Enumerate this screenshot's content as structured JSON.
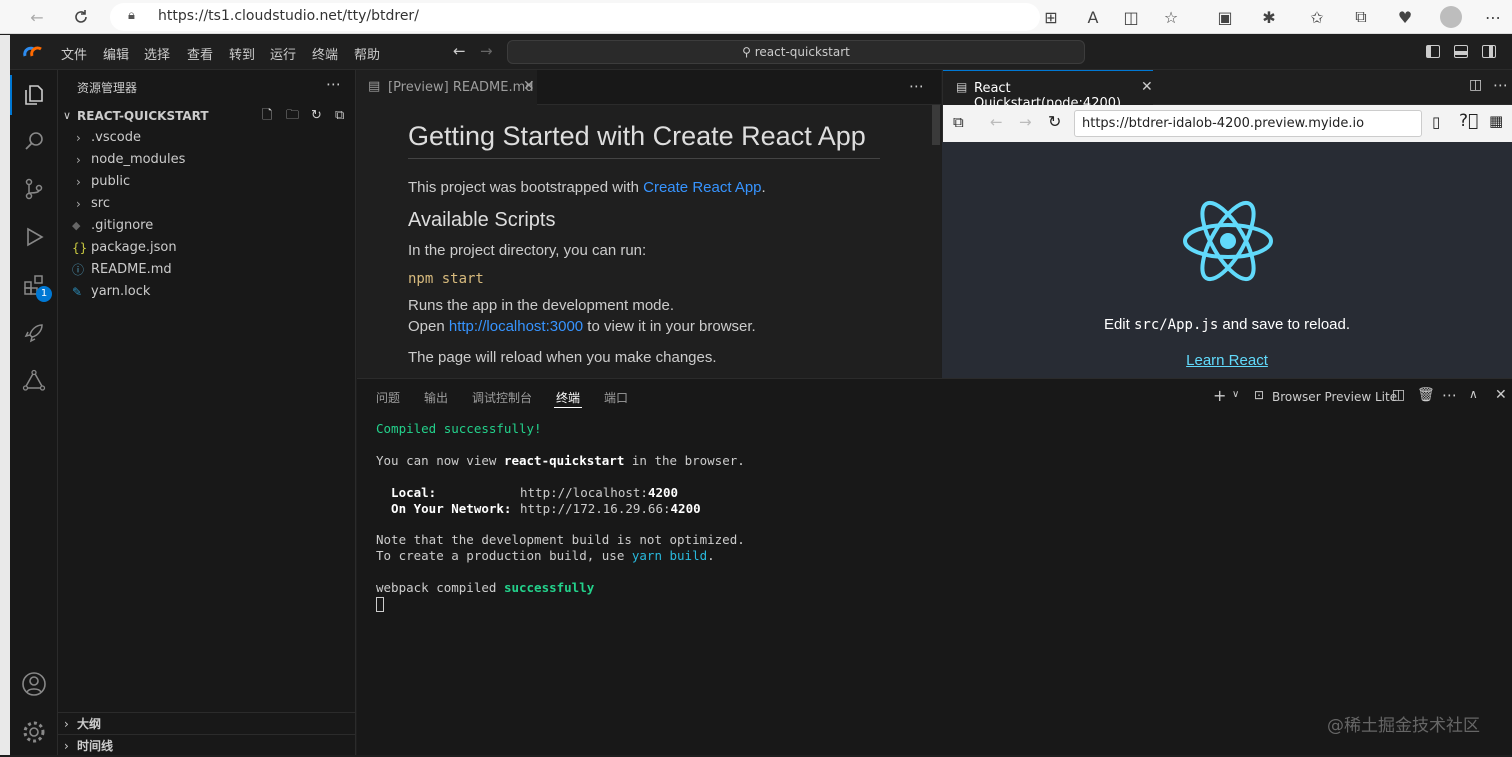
{
  "browser": {
    "url": "https://ts1.cloudstudio.net/tty/btdrer/"
  },
  "menu": [
    "文件",
    "编辑",
    "选择",
    "查看",
    "转到",
    "运行",
    "终端",
    "帮助"
  ],
  "command_center": "react-quickstart",
  "sidebar": {
    "title": "资源管理器",
    "project": "REACT-QUICKSTART",
    "items": [
      {
        "label": ".vscode",
        "type": "folder"
      },
      {
        "label": "node_modules",
        "type": "folder"
      },
      {
        "label": "public",
        "type": "folder"
      },
      {
        "label": "src",
        "type": "folder"
      },
      {
        "label": ".gitignore",
        "type": "file"
      },
      {
        "label": "package.json",
        "type": "file"
      },
      {
        "label": "README.md",
        "type": "file"
      },
      {
        "label": "yarn.lock",
        "type": "file"
      }
    ],
    "outline": "大纲",
    "timeline": "时间线"
  },
  "extensions_badge": "1",
  "editor": {
    "tab": "[Preview] README.md",
    "h1": "Getting Started with Create React App",
    "p1_pre": "This project was bootstrapped with ",
    "p1_link": "Create React App",
    "p1_post": ".",
    "h2": "Available Scripts",
    "p2": "In the project directory, you can run:",
    "code": "npm start",
    "p3": "Runs the app in the development mode.",
    "p4_pre": "Open ",
    "p4_link": "http://localhost:3000",
    "p4_post": " to view it in your browser.",
    "p5": "The page will reload when you make changes."
  },
  "preview": {
    "tab": "React Quickstart(node:4200)",
    "url": "https://btdrer-idalob-4200.preview.myide.io",
    "edit_pre": "Edit ",
    "edit_code": "src/App.js",
    "edit_post": " and save to reload.",
    "link": "Learn React"
  },
  "panel": {
    "tabs": [
      "问题",
      "输出",
      "调试控制台",
      "终端",
      "端口"
    ],
    "active_tab": "终端",
    "terminal_name": "Browser Preview Lite",
    "lines": {
      "compiled": "Compiled successfully!",
      "view_pre": "You can now view ",
      "view_bold": "react-quickstart",
      "view_post": " in the browser.",
      "local_label": "  Local:",
      "local_url": "http://localhost:",
      "local_port": "4200",
      "network_label": "  On Your Network:",
      "network_url": "http://172.16.29.66:",
      "network_port": "4200",
      "note1": "Note that the development build is not optimized.",
      "note2_pre": "To create a production build, use ",
      "note2_cmd": "yarn build",
      "note2_post": ".",
      "webpack_pre": "webpack compiled ",
      "webpack_ok": "successfully"
    }
  },
  "watermark": "@稀土掘金技术社区",
  "colors": {
    "accent": "#0078d4",
    "react": "#61dafb",
    "link": "#3794ff",
    "success": "#23d18b"
  }
}
